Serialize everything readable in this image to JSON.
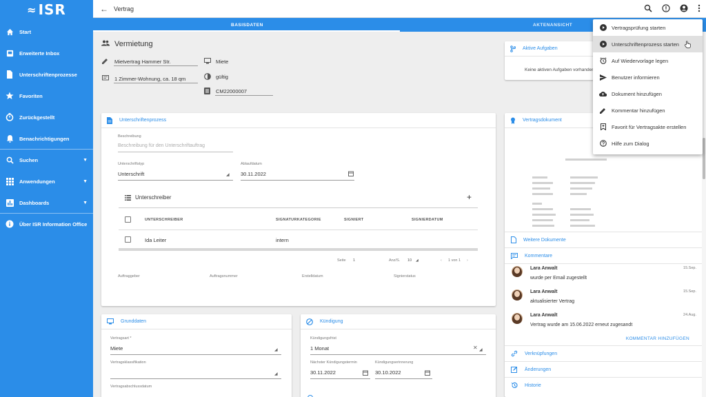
{
  "app": {
    "logo": "ISR"
  },
  "sidebar": {
    "items": [
      {
        "label": "Start",
        "icon": "home-icon"
      },
      {
        "label": "Erweiterte Inbox",
        "icon": "inbox-icon"
      },
      {
        "label": "Unterschriftenprozesse",
        "icon": "document-icon"
      },
      {
        "label": "Favoriten",
        "icon": "star-icon"
      },
      {
        "label": "Zurückgestellt",
        "icon": "timer-icon"
      },
      {
        "label": "Benachrichtigungen",
        "icon": "bell-icon"
      },
      {
        "label": "Suchen",
        "icon": "search-icon"
      },
      {
        "label": "Anwendungen",
        "icon": "apps-grid-icon"
      },
      {
        "label": "Dashboards",
        "icon": "bar-chart-icon"
      },
      {
        "label": "Über ISR Information Office",
        "icon": "info-icon"
      }
    ]
  },
  "topbar": {
    "title": "Vertrag"
  },
  "tabs": {
    "basisdaten": "BASISDATEN",
    "aktenansicht": "AKTENANSICHT"
  },
  "header": {
    "title": "Vermietung",
    "name_value": "Mietvertrag Hammer Str.",
    "desc_value": "1 Zimmer-Wohnung, ca. 18 qm",
    "type_value": "Miete",
    "status_value": "gültig",
    "number_value": "CM22000007"
  },
  "tasks": {
    "title": "Aktive Aufgaben",
    "empty": "Keine aktiven Aufgaben vorhanden"
  },
  "signature": {
    "title": "Unterschriftenprozess",
    "desc_label": "Beschreibung",
    "desc_placeholder": "Beschreibung für den Unterschriftauftrag",
    "type_label": "Unterschriftstyp",
    "type_value": "Unterschrift",
    "expiry_label": "Ablaufdatum",
    "expiry_value": "30.11.2022",
    "signers_title": "Unterschreiber",
    "columns": [
      "UNTERSCHREIBER",
      "SIGNATURKATEGORIE",
      "SIGNIERT",
      "SIGNIERDATUM"
    ],
    "rows": [
      {
        "name": "Ida Leiter",
        "category": "intern",
        "signed": "",
        "date": ""
      }
    ],
    "pager": {
      "page_label": "Seite",
      "page": "1",
      "count_label": "Anz/S.",
      "count": "10",
      "range": "1 von 1"
    },
    "footer": [
      "Auftraggeber",
      "Auftragsnummer",
      "Erstelldatum",
      "Signierstatus"
    ]
  },
  "grunddaten": {
    "title": "Grunddaten",
    "type_label": "Vertragsart *",
    "type_value": "Miete",
    "class_label": "Vertragsklassifikation",
    "date_label": "Vertragsabschlussdatum"
  },
  "kuendigung": {
    "title": "Kündigung",
    "period_label": "Kündigungsfrist",
    "period_value": "1 Monat",
    "next_label": "Nächster Kündigungstermin",
    "next_value": "30.11.2022",
    "reminder_label": "Kündigungserinnerung",
    "reminder_value": "30.10.2022"
  },
  "right": {
    "doc_title": "Vertragsdokument",
    "more_docs": "Weitere Dokumente",
    "comments_title": "Kommentare",
    "comments": [
      {
        "author": "Lara Anwalt",
        "text": "wurde per Email zugestellt",
        "date": "15.Sep."
      },
      {
        "author": "Lara Anwalt",
        "text": "aktualisierter Vertrag",
        "date": "15.Sep."
      },
      {
        "author": "Lara Anwalt",
        "text": "Vertrag wurde am 15.06.2022 erneut zugesandt",
        "date": "24.Aug."
      }
    ],
    "add_comment": "KOMMENTAR HINZUFÜGEN",
    "links": "Verknüpfungen",
    "changes": "Änderungen",
    "history": "Historie"
  },
  "menu": {
    "items": [
      {
        "label": "Vertragsprüfung starten",
        "icon": "play-circle-icon"
      },
      {
        "label": "Unterschriftenprozess starten",
        "icon": "play-circle-icon"
      },
      {
        "label": "Auf Wiedervorlage legen",
        "icon": "alarm-icon"
      },
      {
        "label": "Benutzer informieren",
        "icon": "send-icon"
      },
      {
        "label": "Dokument hinzufügen",
        "icon": "cloud-upload-icon"
      },
      {
        "label": "Kommentar hinzufügen",
        "icon": "pencil-icon"
      },
      {
        "label": "Favorit für Vertragsakte erstellen",
        "icon": "bookmark-icon"
      },
      {
        "label": "Hilfe zum Dialog",
        "icon": "help-circle-icon"
      }
    ]
  },
  "colors": {
    "primary": "#2b8de8",
    "highlight": "#e0e0e0"
  }
}
